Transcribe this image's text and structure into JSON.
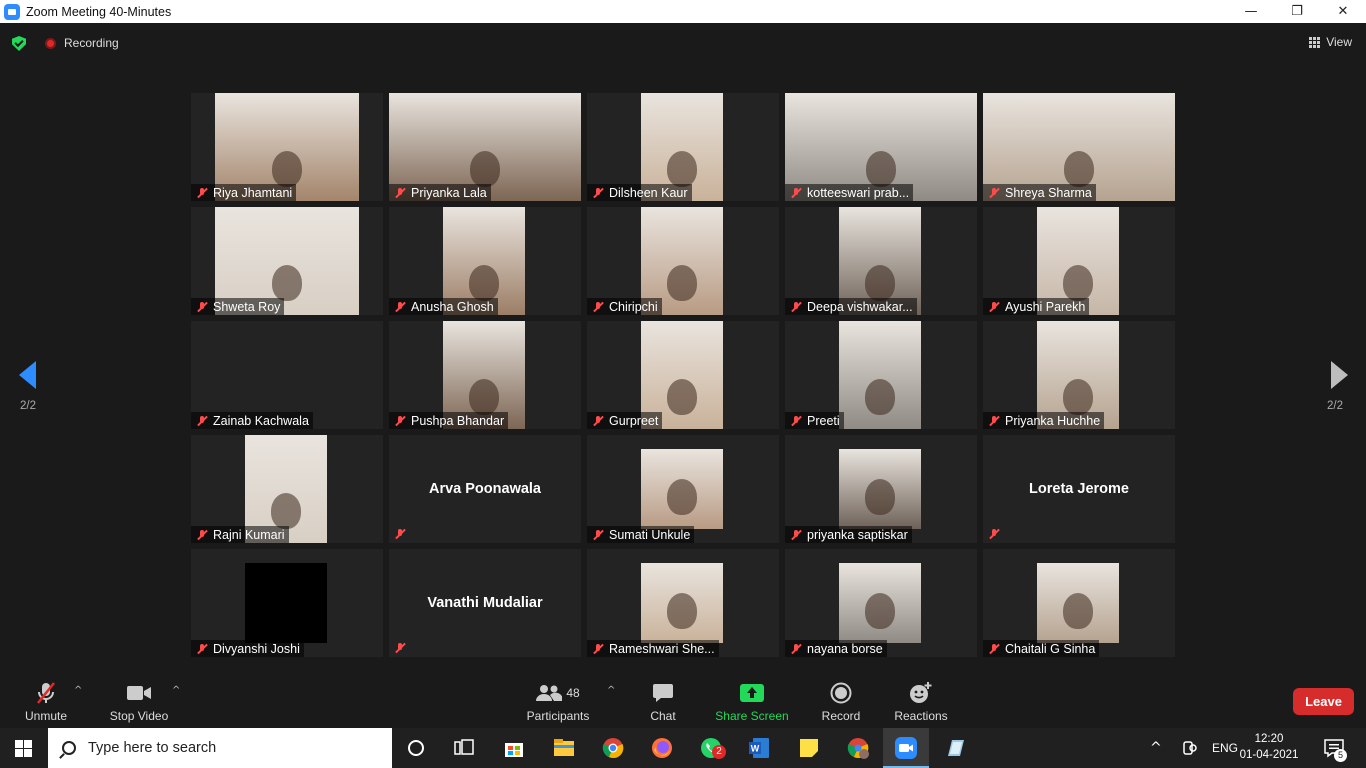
{
  "window": {
    "title": "Zoom Meeting 40-Minutes"
  },
  "meeting": {
    "recording_label": "Recording",
    "view_label": "View"
  },
  "pager": {
    "left": "2/2",
    "right": "2/2"
  },
  "participants": [
    {
      "name": "Riya Jhamtani",
      "video": true
    },
    {
      "name": "Priyanka Lala",
      "video": true
    },
    {
      "name": "Dilsheen Kaur",
      "video": true
    },
    {
      "name": "kotteeswari prab...",
      "video": true
    },
    {
      "name": "Shreya Sharma",
      "video": true
    },
    {
      "name": "Shweta Roy",
      "video": true
    },
    {
      "name": "Anusha Ghosh",
      "video": true
    },
    {
      "name": "Chiripchi",
      "video": true
    },
    {
      "name": "Deepa vishwakar...",
      "video": true
    },
    {
      "name": "Ayushi Parekh",
      "video": true
    },
    {
      "name": "Zainab Kachwala",
      "video": false
    },
    {
      "name": "Pushpa Bhandar",
      "video": true
    },
    {
      "name": "Gurpreet",
      "video": true
    },
    {
      "name": "Preeti",
      "video": true
    },
    {
      "name": "Priyanka Huchhe",
      "video": true
    },
    {
      "name": "Rajni Kumari",
      "video": true
    },
    {
      "name": "Arva Poonawala",
      "video": false,
      "name_only": true
    },
    {
      "name": "Sumati Unkule",
      "video": true
    },
    {
      "name": "priyanka saptiskar",
      "video": true
    },
    {
      "name": "Loreta Jerome",
      "video": false,
      "name_only": true
    },
    {
      "name": "Divyanshi Joshi",
      "video": true
    },
    {
      "name": "Vanathi Mudaliar",
      "video": false,
      "name_only": true
    },
    {
      "name": "Rameshwari She...",
      "video": true
    },
    {
      "name": "nayana borse",
      "video": true
    },
    {
      "name": "Chaitali G Sinha",
      "video": true
    }
  ],
  "toolbar": {
    "unmute": "Unmute",
    "stop_video": "Stop Video",
    "participants_count": "48",
    "participants": "Participants",
    "chat": "Chat",
    "share_screen": "Share Screen",
    "record": "Record",
    "reactions": "Reactions",
    "leave": "Leave"
  },
  "taskbar": {
    "search_placeholder": "Type here to search",
    "whatsapp_badge": "2",
    "language": "ENG",
    "time": "12:20",
    "date": "01-04-2021",
    "notifications": "5"
  },
  "colors": {
    "accent": "#2d8cff",
    "leave": "#d62c2c",
    "share": "#23d959",
    "muted": "#ff4b4b"
  }
}
